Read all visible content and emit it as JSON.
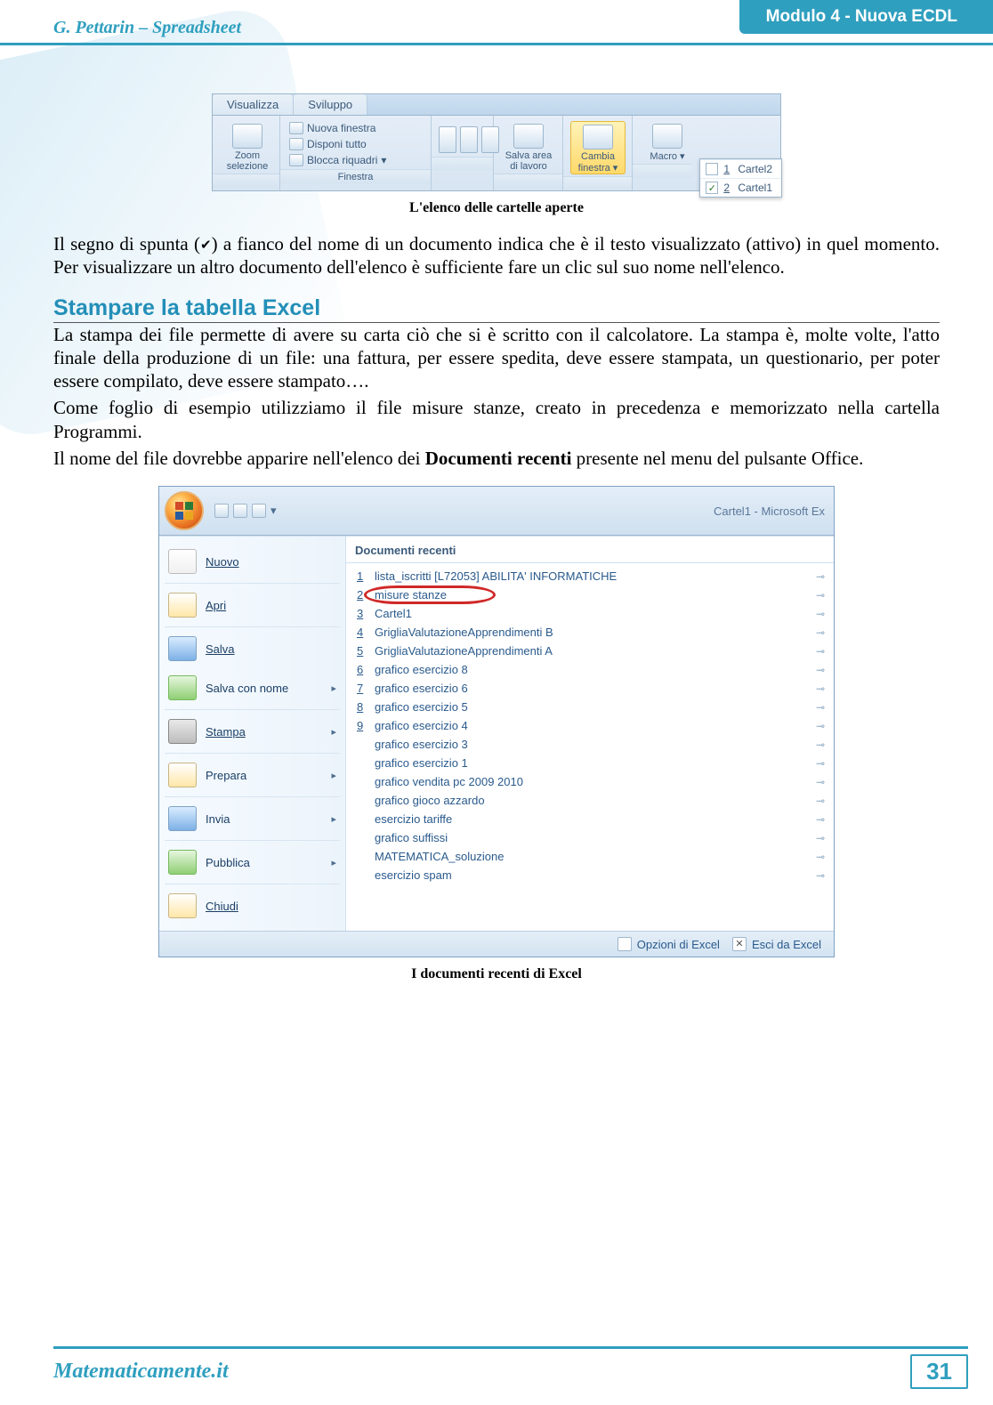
{
  "header": {
    "left": "G. Pettarin – Spreadsheet",
    "right": "Modulo 4 - Nuova ECDL"
  },
  "fig1": {
    "tabs": {
      "view": "Visualizza",
      "dev": "Sviluppo"
    },
    "zoom_sel": "Zoom selezione",
    "new_win": "Nuova finestra",
    "arrange": "Disponi tutto",
    "freeze": "Blocca riquadri",
    "group_finestra": "Finestra",
    "save_ws": "Salva area di lavoro",
    "switch_win": "Cambia finestra",
    "macro": "Macro",
    "winlist": {
      "w1": {
        "num": "1",
        "name": "Cartel2",
        "checked": ""
      },
      "w2": {
        "num": "2",
        "name": "Cartel1",
        "checked": "✓"
      }
    },
    "caption": "L'elenco delle cartelle aperte"
  },
  "para1a": "Il segno di spunta (",
  "checkmark": "✔",
  "para1b": ") a fianco del nome di un documento indica che è il testo visualizzato (attivo) in quel momento. Per visualizzare un altro documento dell'elenco è sufficiente fare un clic sul suo nome nell'elenco.",
  "section_title": "Stampare la tabella Excel",
  "para2": "La stampa dei file permette di avere su carta ciò che si è scritto con il calcolatore. La stampa è, molte volte, l'atto finale della produzione di un file: una fattura, per essere spedita, deve essere stampata, un questionario, per poter essere compilato, deve essere stampato….",
  "para3": "Come foglio di esempio utilizziamo il file misure stanze, creato in precedenza e memorizzato nella cartella Programmi.",
  "para4a": "Il nome del file dovrebbe apparire nell'elenco dei ",
  "para4bold": "Documenti recenti",
  "para4b": " presente nel menu del pulsante Office.",
  "fig2": {
    "title": "Cartel1 - Microsoft Ex",
    "menu": {
      "nuovo": "Nuovo",
      "apri": "Apri",
      "salva": "Salva",
      "salva_nome": "Salva con nome",
      "stampa": "Stampa",
      "prepara": "Prepara",
      "invia": "Invia",
      "pubblica": "Pubblica",
      "chiudi": "Chiudi"
    },
    "recents_hdr": "Documenti recenti",
    "recents": {
      "r1": {
        "num": "1",
        "name": "lista_iscritti [L72053]  ABILITA' INFORMATICHE"
      },
      "r2": {
        "num": "2",
        "name": "misure stanze"
      },
      "r3": {
        "num": "3",
        "name": "Cartel1"
      },
      "r4": {
        "num": "4",
        "name": "GrigliaValutazioneApprendimenti B"
      },
      "r5": {
        "num": "5",
        "name": "GrigliaValutazioneApprendimenti A"
      },
      "r6": {
        "num": "6",
        "name": "grafico esercizio 8"
      },
      "r7": {
        "num": "7",
        "name": "grafico esercizio 6"
      },
      "r8": {
        "num": "8",
        "name": "grafico esercizio 5"
      },
      "r9": {
        "num": "9",
        "name": "grafico esercizio 4"
      },
      "r10": {
        "num": "",
        "name": "grafico esercizio 3"
      },
      "r11": {
        "num": "",
        "name": "grafico esercizio 1"
      },
      "r12": {
        "num": "",
        "name": "grafico vendita pc 2009 2010"
      },
      "r13": {
        "num": "",
        "name": "grafico gioco azzardo"
      },
      "r14": {
        "num": "",
        "name": "esercizio tariffe"
      },
      "r15": {
        "num": "",
        "name": "grafico suffissi"
      },
      "r16": {
        "num": "",
        "name": "MATEMATICA_soluzione"
      },
      "r17": {
        "num": "",
        "name": "esercizio spam"
      }
    },
    "footer": {
      "opts": "Opzioni di Excel",
      "exit": "Esci da Excel"
    },
    "caption": "I documenti recenti di Excel"
  },
  "footer": {
    "site": "Matematicamente.it",
    "page": "31"
  }
}
